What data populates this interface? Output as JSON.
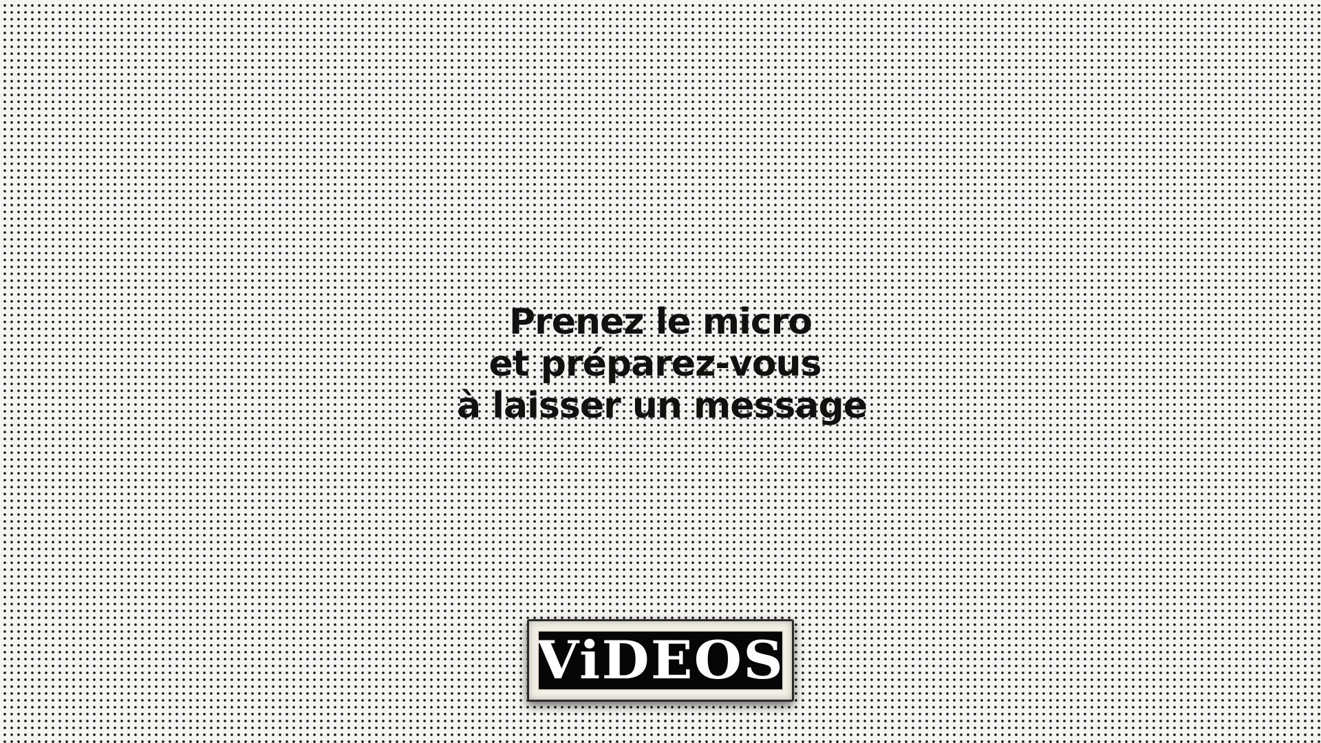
{
  "message": {
    "line1": "Prenez le micro",
    "line2": "et préparez-vous",
    "line3": "à laisser un message"
  },
  "videos_button": {
    "label": "ViDEOS"
  },
  "colors": {
    "background": "#f4f4f2",
    "dots": "#1a1a1a",
    "text": "#111111",
    "button_face": "#060606",
    "button_frame": "#f2efe6"
  }
}
